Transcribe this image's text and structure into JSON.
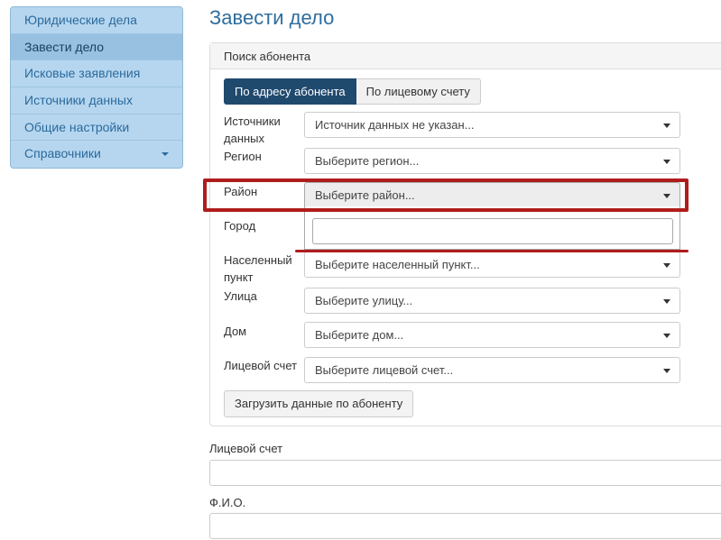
{
  "sidebar": {
    "items": [
      {
        "label": "Юридические дела"
      },
      {
        "label": "Завести дело"
      },
      {
        "label": "Исковые заявления"
      },
      {
        "label": "Источники данных"
      },
      {
        "label": "Общие настройки"
      },
      {
        "label": "Справочники"
      }
    ],
    "active_index": 1
  },
  "page": {
    "title": "Завести дело"
  },
  "panel": {
    "heading": "Поиск абонента",
    "tabs": [
      {
        "label": "По адресу абонента",
        "active": true
      },
      {
        "label": "По лицевому счету",
        "active": false
      }
    ],
    "fields": {
      "source": {
        "label": "Источники данных",
        "value": "Источник данных не указан..."
      },
      "region": {
        "label": "Регион",
        "value": "Выберите регион..."
      },
      "district": {
        "label": "Район",
        "value": "Выберите район..."
      },
      "city": {
        "label": "Город"
      },
      "settlement": {
        "label": "Населенный пункт",
        "value": "Выберите населенный пункт..."
      },
      "street": {
        "label": "Улица",
        "value": "Выберите улицу..."
      },
      "house": {
        "label": "Дом",
        "value": "Выберите дом..."
      },
      "account": {
        "label": "Лицевой счет",
        "value": "Выберите лицевой счет..."
      }
    },
    "load_button": "Загрузить данные по абоненту"
  },
  "form": {
    "account_label": "Лицевой счет",
    "fio_label": "Ф.И.О."
  },
  "colors": {
    "accent": "#2e6d9e",
    "active_tab": "#20496e",
    "highlight": "#b01c1c"
  }
}
